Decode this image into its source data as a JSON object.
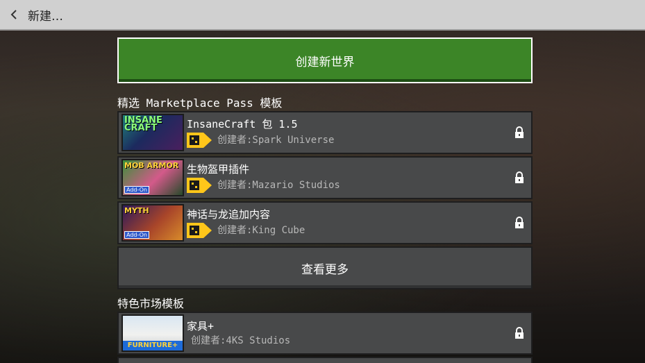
{
  "topbar": {
    "back_icon": "chevron-left-icon",
    "title": "新建…"
  },
  "create_button": {
    "label": "创建新世界"
  },
  "marketplace_pass": {
    "header": "精选 Marketplace Pass 模板",
    "items": [
      {
        "title": "InsaneCraft 包 1.5",
        "creator": "创建者:Spark Universe",
        "thumb_text": "INSANE CRAFT",
        "locked": true
      },
      {
        "title": "生物盔甲插件",
        "creator": "创建者:Mazario Studios",
        "thumb_text": "MOB ARMOR",
        "thumb_tag": "Add-On",
        "locked": true
      },
      {
        "title": "神话与龙追加内容",
        "creator": "创建者:King Cube",
        "thumb_text": "MYTH",
        "thumb_tag": "Add-On",
        "locked": true
      }
    ],
    "see_more_label": "查看更多"
  },
  "featured_market": {
    "header": "特色市场模板",
    "items": [
      {
        "title": "家具+",
        "creator": "创建者:4KS Studios",
        "thumb_text": "FURNITURE+",
        "locked": true
      }
    ]
  },
  "colors": {
    "create_green": "#3c8527",
    "row_bg": "#48494a",
    "badge_yellow": "#ffc61a",
    "topbar_bg": "#d0d0d0"
  }
}
